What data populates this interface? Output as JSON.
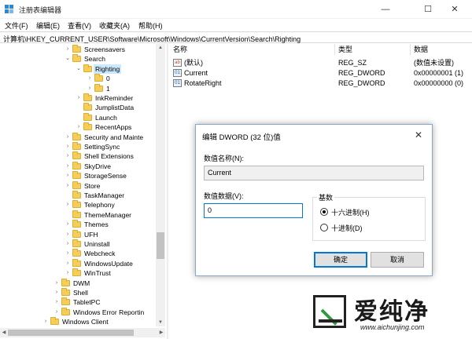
{
  "window": {
    "title": "注册表编辑器",
    "minimize": "—",
    "maximize": "☐",
    "close": "✕"
  },
  "menu": [
    "文件(F)",
    "编辑(E)",
    "查看(V)",
    "收藏夹(A)",
    "帮助(H)"
  ],
  "address": "计算机\\HKEY_CURRENT_USER\\Software\\Microsoft\\Windows\\CurrentVersion\\Search\\Righting",
  "tree": [
    {
      "label": "Screensavers",
      "level": 2,
      "chev": "›"
    },
    {
      "label": "Search",
      "level": 2,
      "chev": "⌄"
    },
    {
      "label": "Righting",
      "level": 3,
      "chev": "⌄",
      "selected": true
    },
    {
      "label": "0",
      "level": 4,
      "chev": "›"
    },
    {
      "label": "1",
      "level": 4,
      "chev": "›"
    },
    {
      "label": "InkReminder",
      "level": 3,
      "chev": "›"
    },
    {
      "label": "JumplistData",
      "level": 3,
      "chev": ""
    },
    {
      "label": "Launch",
      "level": 3,
      "chev": ""
    },
    {
      "label": "RecentApps",
      "level": 3,
      "chev": "›"
    },
    {
      "label": "Security and Mainte",
      "level": 2,
      "chev": "›"
    },
    {
      "label": "SettingSync",
      "level": 2,
      "chev": "›"
    },
    {
      "label": "Shell Extensions",
      "level": 2,
      "chev": "›"
    },
    {
      "label": "SkyDrive",
      "level": 2,
      "chev": "›"
    },
    {
      "label": "StorageSense",
      "level": 2,
      "chev": "›"
    },
    {
      "label": "Store",
      "level": 2,
      "chev": "›"
    },
    {
      "label": "TaskManager",
      "level": 2,
      "chev": ""
    },
    {
      "label": "Telephony",
      "level": 2,
      "chev": "›"
    },
    {
      "label": "ThemeManager",
      "level": 2,
      "chev": ""
    },
    {
      "label": "Themes",
      "level": 2,
      "chev": "›"
    },
    {
      "label": "UFH",
      "level": 2,
      "chev": "›"
    },
    {
      "label": "Uninstall",
      "level": 2,
      "chev": "›"
    },
    {
      "label": "Webcheck",
      "level": 2,
      "chev": "›"
    },
    {
      "label": "WindowsUpdate",
      "level": 2,
      "chev": "›"
    },
    {
      "label": "WinTrust",
      "level": 2,
      "chev": "›"
    },
    {
      "label": "DWM",
      "level": 1,
      "chev": "›"
    },
    {
      "label": "Shell",
      "level": 1,
      "chev": "›"
    },
    {
      "label": "TabletPC",
      "level": 1,
      "chev": "›"
    },
    {
      "label": "Windows Error Reportin",
      "level": 1,
      "chev": "›"
    },
    {
      "label": "Windows Client",
      "level": 0,
      "chev": "›"
    }
  ],
  "columns": {
    "name": "名称",
    "type": "类型",
    "data": "数据"
  },
  "values": [
    {
      "icon": "ab",
      "kind": "sz",
      "name": "(默认)",
      "type": "REG_SZ",
      "data": "(数值未设置)"
    },
    {
      "icon": "01",
      "kind": "dw",
      "name": "Current",
      "type": "REG_DWORD",
      "data": "0x00000001 (1)"
    },
    {
      "icon": "01",
      "kind": "dw",
      "name": "RotateRight",
      "type": "REG_DWORD",
      "data": "0x00000000 (0)"
    }
  ],
  "dialog": {
    "title": "编辑 DWORD (32 位)值",
    "close": "✕",
    "name_label": "数值名称(N):",
    "name_value": "Current",
    "data_label": "数值数据(V):",
    "data_value": "0",
    "base_label": "基数",
    "hex_label": "十六进制(H)",
    "dec_label": "十进制(D)",
    "ok_label": "确定",
    "cancel_label": "取消"
  },
  "watermark": {
    "text": "爱纯净",
    "url": "www.aichunjing.com"
  }
}
